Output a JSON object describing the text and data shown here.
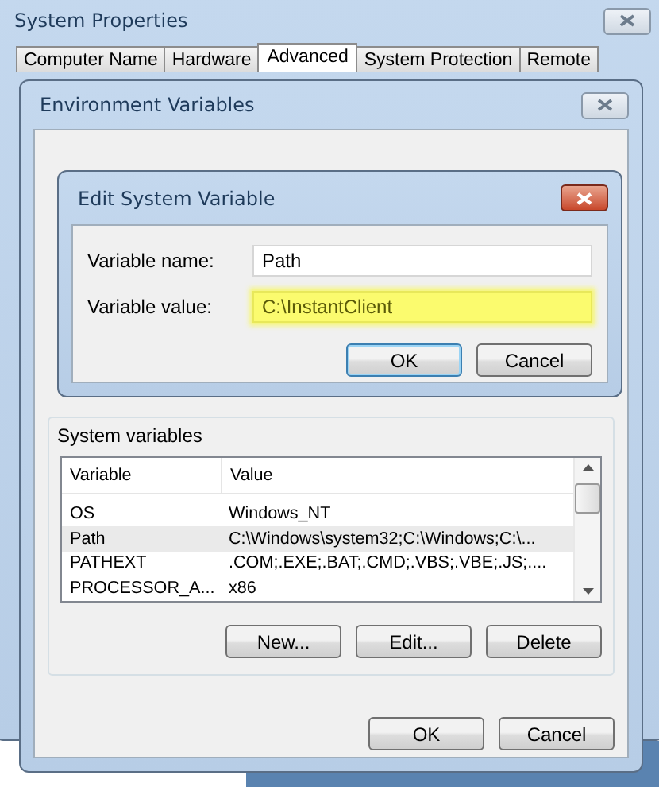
{
  "window": {
    "title": "System Properties"
  },
  "tabs": [
    {
      "label": "Computer Name",
      "selected": false
    },
    {
      "label": "Hardware",
      "selected": false
    },
    {
      "label": "Advanced",
      "selected": true
    },
    {
      "label": "System Protection",
      "selected": false
    },
    {
      "label": "Remote",
      "selected": false
    }
  ],
  "environment_dialog": {
    "title": "Environment Variables",
    "system_variables": {
      "label": "System variables",
      "columns": [
        "Variable",
        "Value"
      ],
      "rows": [
        {
          "variable": "OS",
          "value": "Windows_NT",
          "selected": false
        },
        {
          "variable": "Path",
          "value": "C:\\Windows\\system32;C:\\Windows;C:\\...",
          "selected": true
        },
        {
          "variable": "PATHEXT",
          "value": ".COM;.EXE;.BAT;.CMD;.VBS;.VBE;.JS;....",
          "selected": false
        },
        {
          "variable": "PROCESSOR_A...",
          "value": "x86",
          "selected": false
        }
      ],
      "buttons": [
        "New...",
        "Edit...",
        "Delete"
      ]
    },
    "buttons": [
      "OK",
      "Cancel"
    ]
  },
  "edit_dialog": {
    "title": "Edit System Variable",
    "fields": [
      {
        "label": "Variable name:",
        "value": "Path",
        "highlighted": false
      },
      {
        "label": "Variable value:",
        "value": "C:\\InstantClient",
        "highlighted": true
      }
    ],
    "buttons": [
      {
        "label": "OK",
        "default": true
      },
      {
        "label": "Cancel",
        "default": false
      }
    ]
  }
}
